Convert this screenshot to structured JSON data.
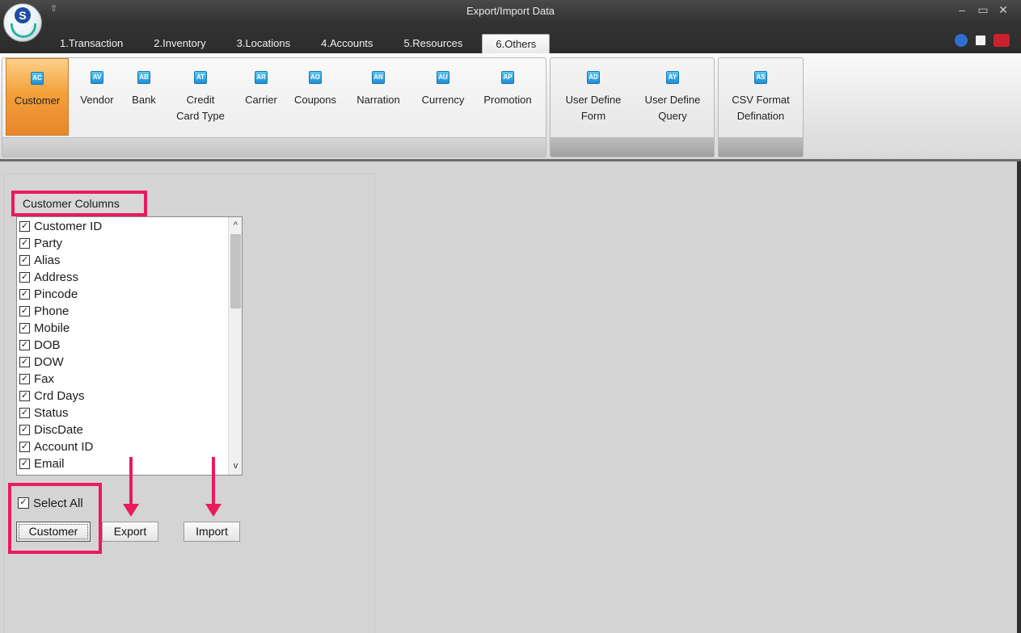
{
  "window": {
    "title": "Export/Import Data",
    "qat_glyph": "⇧",
    "controls": [
      "–",
      "▭",
      "✕"
    ]
  },
  "tabs": [
    {
      "label": "1.Transaction"
    },
    {
      "label": "2.Inventory"
    },
    {
      "label": "3.Locations"
    },
    {
      "label": "4.Accounts"
    },
    {
      "label": "5.Resources"
    },
    {
      "label": "6.Others"
    }
  ],
  "title_icons": [
    "help-icon",
    "document-icon",
    "exit-icon"
  ],
  "ribbon": {
    "group_master": [
      {
        "label": "Customer",
        "icon": "AC"
      },
      {
        "label": "Vendor",
        "icon": "AV"
      },
      {
        "label": "Bank",
        "icon": "AB"
      },
      {
        "label": "Credit Card Type",
        "line1": "Credit",
        "line2": "Card Type",
        "icon": "AT"
      },
      {
        "label": "Carrier",
        "icon": "AR"
      },
      {
        "label": "Coupons",
        "icon": "AO"
      },
      {
        "label": "Narration",
        "icon": "AN"
      },
      {
        "label": "Currency",
        "icon": "AU"
      },
      {
        "label": "Promotion",
        "icon": "AP"
      }
    ],
    "group_user": [
      {
        "line1": "User Define",
        "line2": "Form",
        "icon": "AD"
      },
      {
        "line1": "User Define",
        "line2": "Query",
        "icon": "AY"
      }
    ],
    "group_csv": [
      {
        "line1": "CSV Format",
        "line2": "Defination",
        "icon": "AS"
      }
    ]
  },
  "columns_header": "Customer Columns",
  "columns": [
    "Customer ID",
    "Party",
    "Alias",
    "Address",
    "Pincode",
    "Phone",
    "Mobile",
    "DOB",
    "DOW",
    "Fax",
    "Crd Days",
    "Status",
    "DiscDate",
    "Account ID",
    "Email"
  ],
  "check_glyph": "✓",
  "select_all": "Select All",
  "buttons": {
    "customer": "Customer",
    "export": "Export",
    "import": "Import"
  },
  "scroll": {
    "up": "^",
    "down": "v"
  },
  "colors": {
    "highlight": "#ea1b5d",
    "active_ribbon": "#f3a13b",
    "icon_blue": "#1f8fd4"
  }
}
